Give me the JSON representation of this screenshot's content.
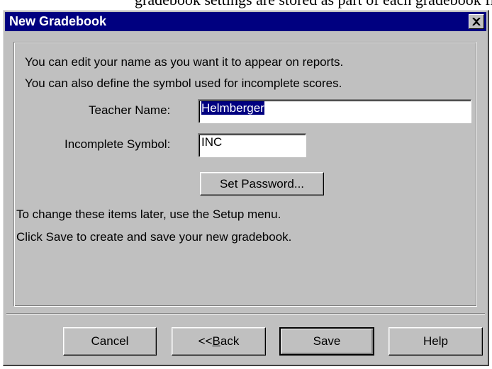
{
  "top_text": "gradebook settings are stored as part of each gradebook file",
  "dialog": {
    "title": "New Gradebook",
    "close_symbol": "×",
    "intro_line1": "You can edit your name as you want it to appear on reports.",
    "intro_line2": "You can also define the symbol used for incomplete scores.",
    "teacher_name_label": "Teacher Name:",
    "teacher_name_value": "Helmberger",
    "incomplete_symbol_label": "Incomplete Symbol:",
    "incomplete_symbol_value": "INC",
    "set_password_label": "Set Password...",
    "info_line1": "To change these items later, use the Setup menu.",
    "info_line2": "Click Save to create and save your new gradebook."
  },
  "buttons": {
    "cancel": "Cancel",
    "back_prefix": "<<",
    "back_underlined": "B",
    "back_rest": "ack",
    "save": "Save",
    "help": "Help"
  },
  "colors": {
    "titlebar": "#000080",
    "dialog_face": "#c0c0c0",
    "selection": "#000080"
  }
}
